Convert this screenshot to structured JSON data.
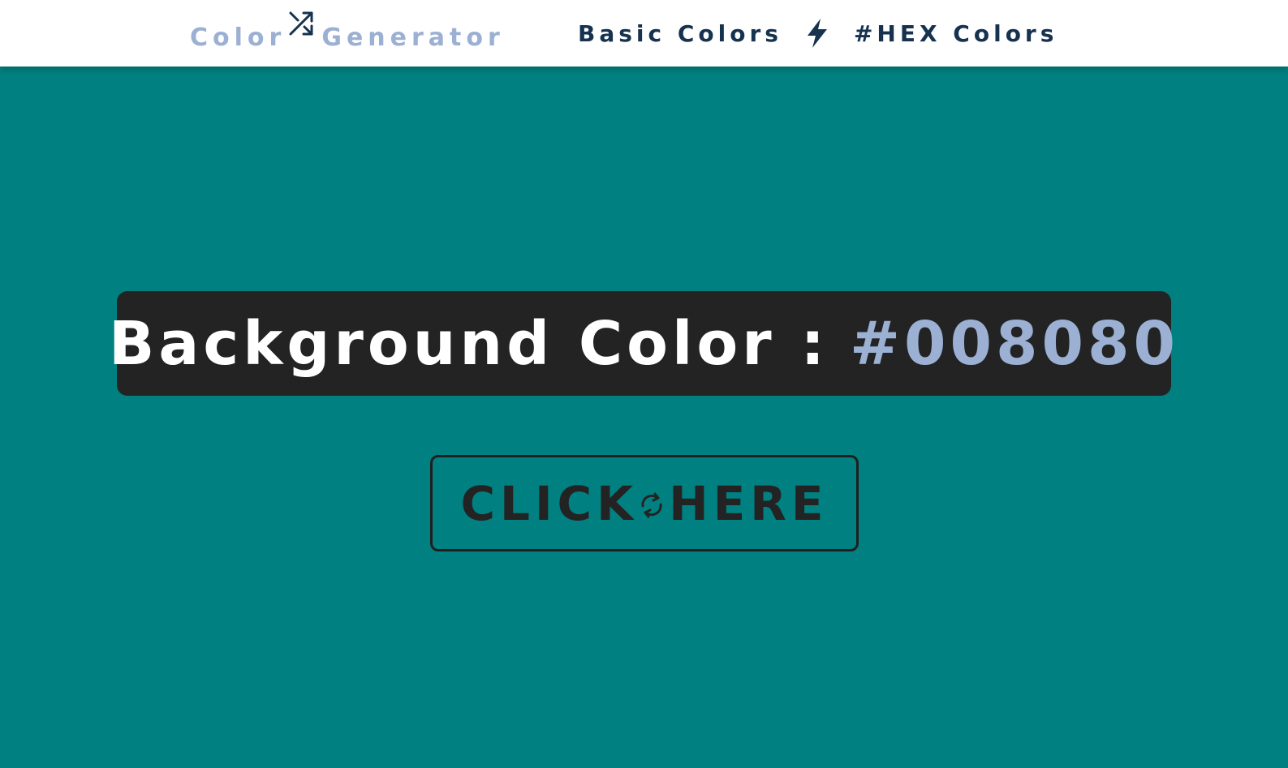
{
  "colors": {
    "background": "#008080",
    "navbar_background": "#ffffff",
    "brand_text": "#9bb0d3",
    "nav_text": "#16324f",
    "panel_background": "#232323",
    "panel_label": "#ffffff",
    "hex_value": "#9bb0d3",
    "button_text": "#232323"
  },
  "nav": {
    "brand": {
      "word1": "Color",
      "icon": "shuffle-icon",
      "word2": "Generator"
    },
    "links": [
      {
        "label": "Basic Colors"
      },
      {
        "label": "#HEX Colors"
      }
    ],
    "separator_icon": "lightning-bolt-icon"
  },
  "main": {
    "label": "Background Color :",
    "value": "#008080"
  },
  "button": {
    "text_left": "CLICK",
    "icon": "refresh-icon",
    "text_right": "HERE"
  }
}
